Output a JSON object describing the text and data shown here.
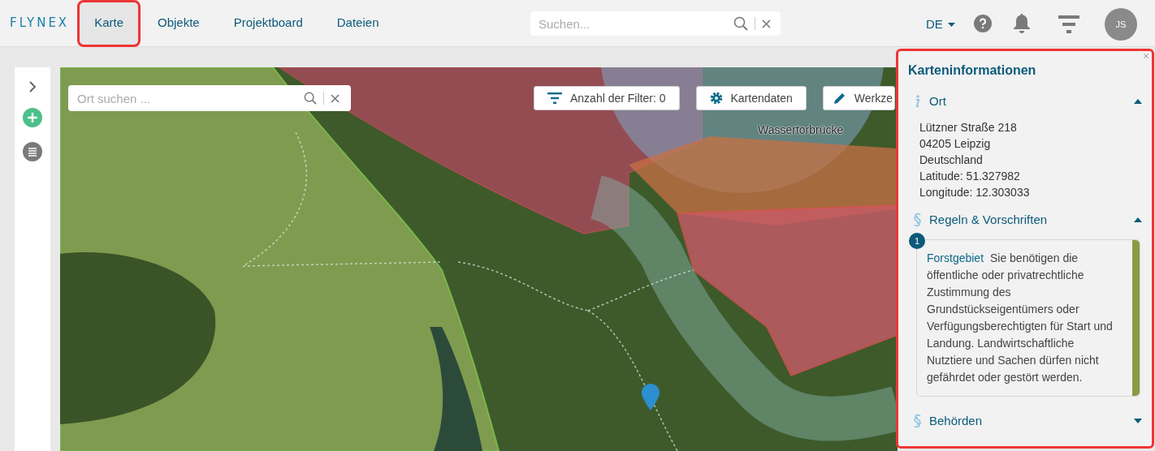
{
  "header": {
    "logo": "FLYNEX",
    "tabs": [
      {
        "label": "Karte",
        "selected": true,
        "highlighted": true
      },
      {
        "label": "Objekte",
        "selected": false,
        "highlighted": false
      },
      {
        "label": "Projektboard",
        "selected": false,
        "highlighted": false
      },
      {
        "label": "Dateien",
        "selected": false,
        "highlighted": false
      }
    ],
    "search": {
      "placeholder": "Suchen..."
    },
    "language": "DE",
    "avatar": "JS"
  },
  "map": {
    "search": {
      "placeholder": "Ort suchen ..."
    },
    "toolbar": [
      {
        "kind": "filter",
        "label": "Anzahl der Filter: 0"
      },
      {
        "kind": "gear",
        "label": "Kartendaten"
      },
      {
        "kind": "pencil",
        "label": "Werkze"
      }
    ],
    "place_label": "Wassertorbrücke"
  },
  "info_panel": {
    "title": "Karteninformationen",
    "highlighted": true,
    "sections": [
      {
        "kind": "info",
        "title": "Ort",
        "expanded": true,
        "lines": [
          "Lützner Straße 218",
          "04205 Leipzig",
          "Deutschland",
          "Latitude: 51.327982",
          "Longitude: 12.303033"
        ]
      },
      {
        "kind": "law",
        "title": "Regeln & Vorschriften",
        "expanded": true,
        "rules": [
          {
            "number": "1",
            "title": "Forstgebiet",
            "text": "Sie benötigen die öffentliche oder privatrechtliche Zustimmung des Grundstückseigentümers oder Verfügungsberechtigten für Start und Landung. Landwirtschaftliche Nutztiere und Sachen dürfen nicht gefährdet oder gestört werden.",
            "color": "#8a9a45"
          }
        ]
      },
      {
        "kind": "law",
        "title": "Behörden",
        "expanded": false
      }
    ]
  }
}
